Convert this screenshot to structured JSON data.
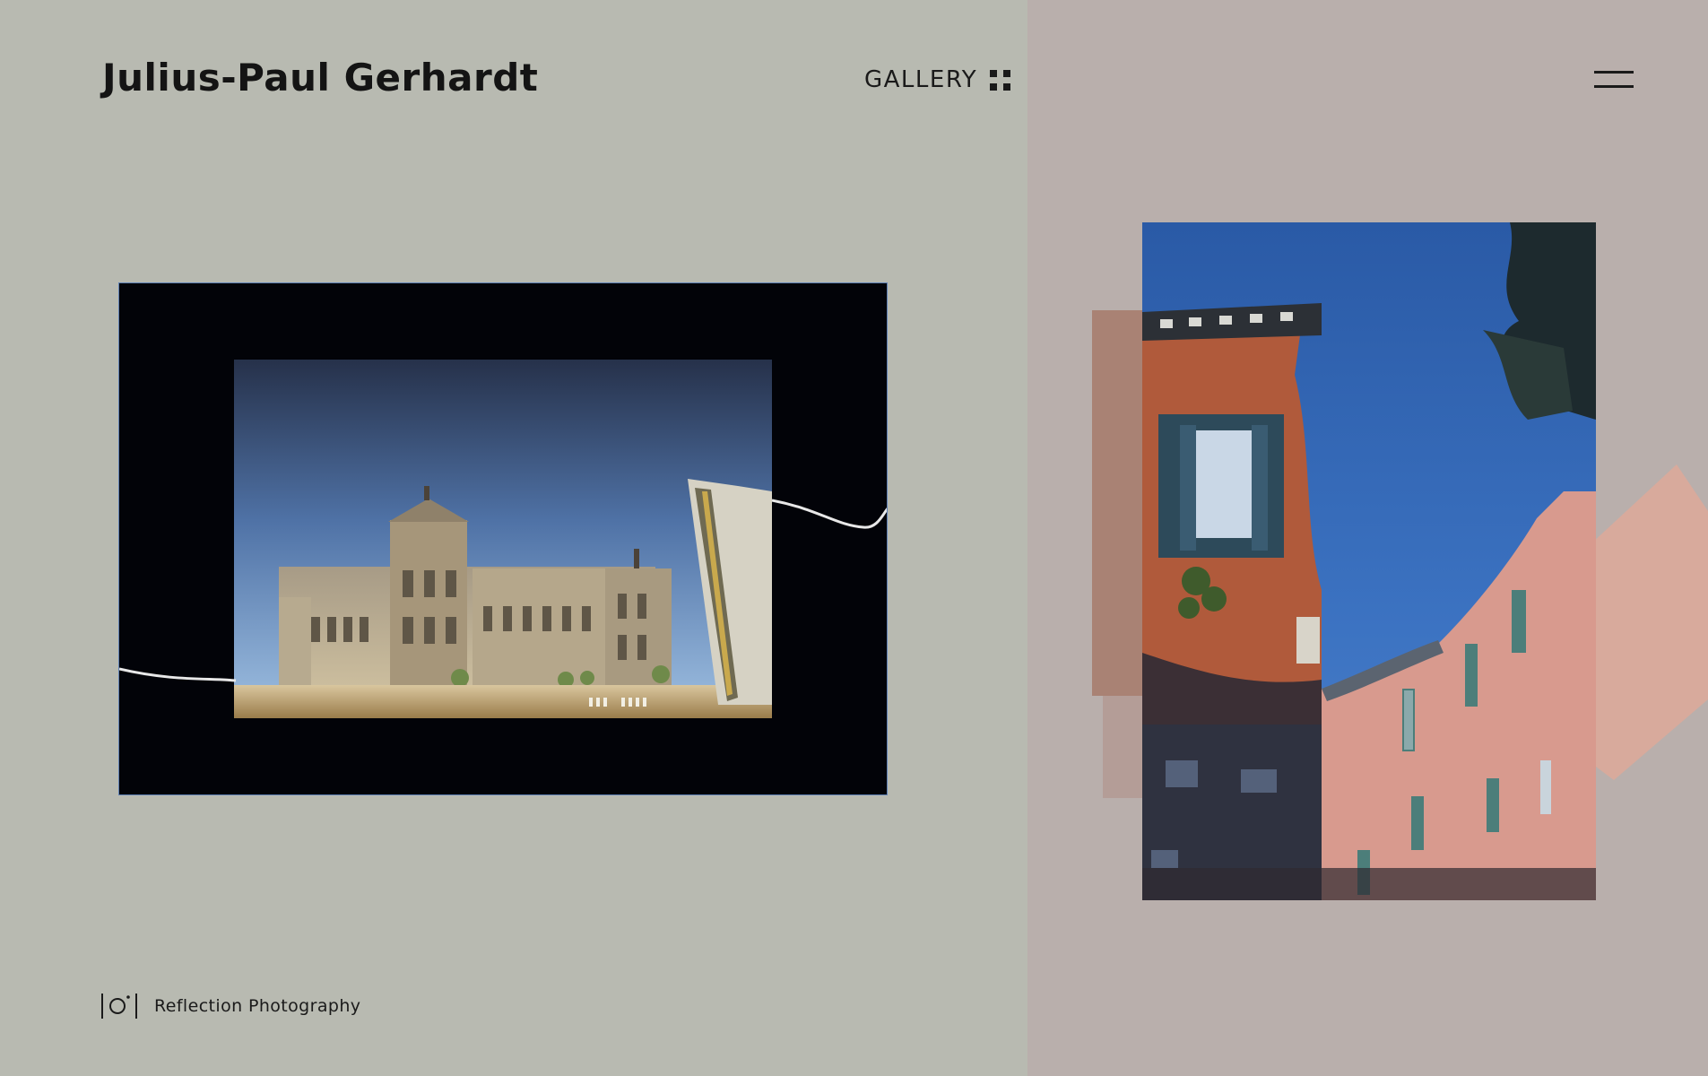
{
  "header": {
    "site_title": "Julius-Paul Gerhardt",
    "gallery_label": "GALLERY",
    "gallery_icon": "grid-dots-icon",
    "menu_icon": "hamburger-menu-icon"
  },
  "main": {
    "left_photo": {
      "subject": "reichstag-reflection-photo"
    },
    "right_photo": {
      "subject": "venice-canal-reflection-photo"
    }
  },
  "footer": {
    "brand_icon": "camera-icon",
    "brand_text": "Reflection Photography"
  },
  "colors": {
    "left_panel_bg": "#b8bab1",
    "right_panel_bg": "#b9afac",
    "text": "#141414",
    "frame_border": "#5d7fb3",
    "accent_terracotta": "#a98274",
    "accent_pink": "#d8aa9c"
  }
}
